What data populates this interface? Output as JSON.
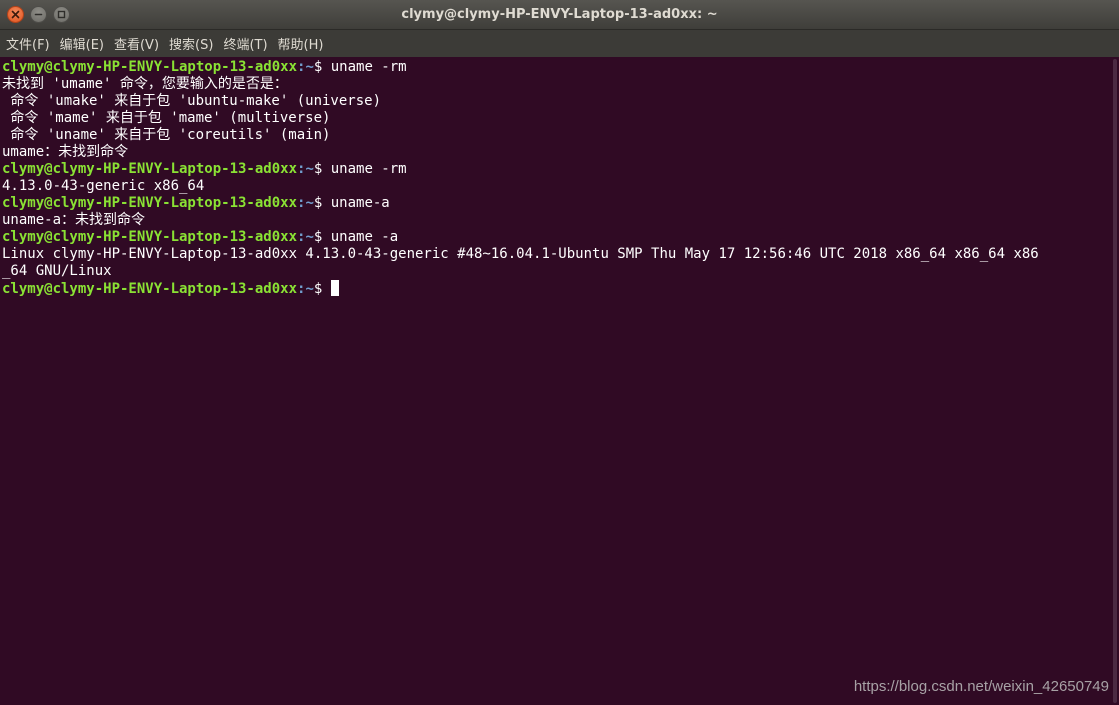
{
  "window": {
    "title": "clymy@clymy-HP-ENVY-Laptop-13-ad0xx: ~"
  },
  "menu": {
    "items": [
      "文件(F)",
      "编辑(E)",
      "查看(V)",
      "搜索(S)",
      "终端(T)",
      "帮助(H)"
    ]
  },
  "prompt": {
    "user_host": "clymy@clymy-HP-ENVY-Laptop-13-ad0xx",
    "path": ":~",
    "symbol": "$ "
  },
  "terminal": {
    "cmd1": "uname -rm",
    "out1_0": "未找到 'umame' 命令，您要输入的是否是：",
    "out1_1": " 命令 'umake' 来自于包 'ubuntu-make' (universe)",
    "out1_2": " 命令 'mame' 来自于包 'mame' (multiverse)",
    "out1_3": " 命令 'uname' 来自于包 'coreutils' (main)",
    "out1_4": "umame：未找到命令",
    "cmd2": "uname -rm",
    "out2_0": "4.13.0-43-generic x86_64",
    "cmd3": "uname-a",
    "out3_0": "uname-a：未找到命令",
    "cmd4": "uname -a",
    "out4_0": "Linux clymy-HP-ENVY-Laptop-13-ad0xx 4.13.0-43-generic #48~16.04.1-Ubuntu SMP Thu May 17 12:56:46 UTC 2018 x86_64 x86_64 x86",
    "out4_1": "_64 GNU/Linux"
  },
  "watermark": "https://blog.csdn.net/weixin_42650749",
  "colors": {
    "background": "#300a24",
    "prompt_user": "#8ae234",
    "prompt_path": "#729fcf",
    "close_button": "#e95420"
  },
  "icons": [
    "close-icon",
    "minimize-icon",
    "maximize-icon"
  ]
}
